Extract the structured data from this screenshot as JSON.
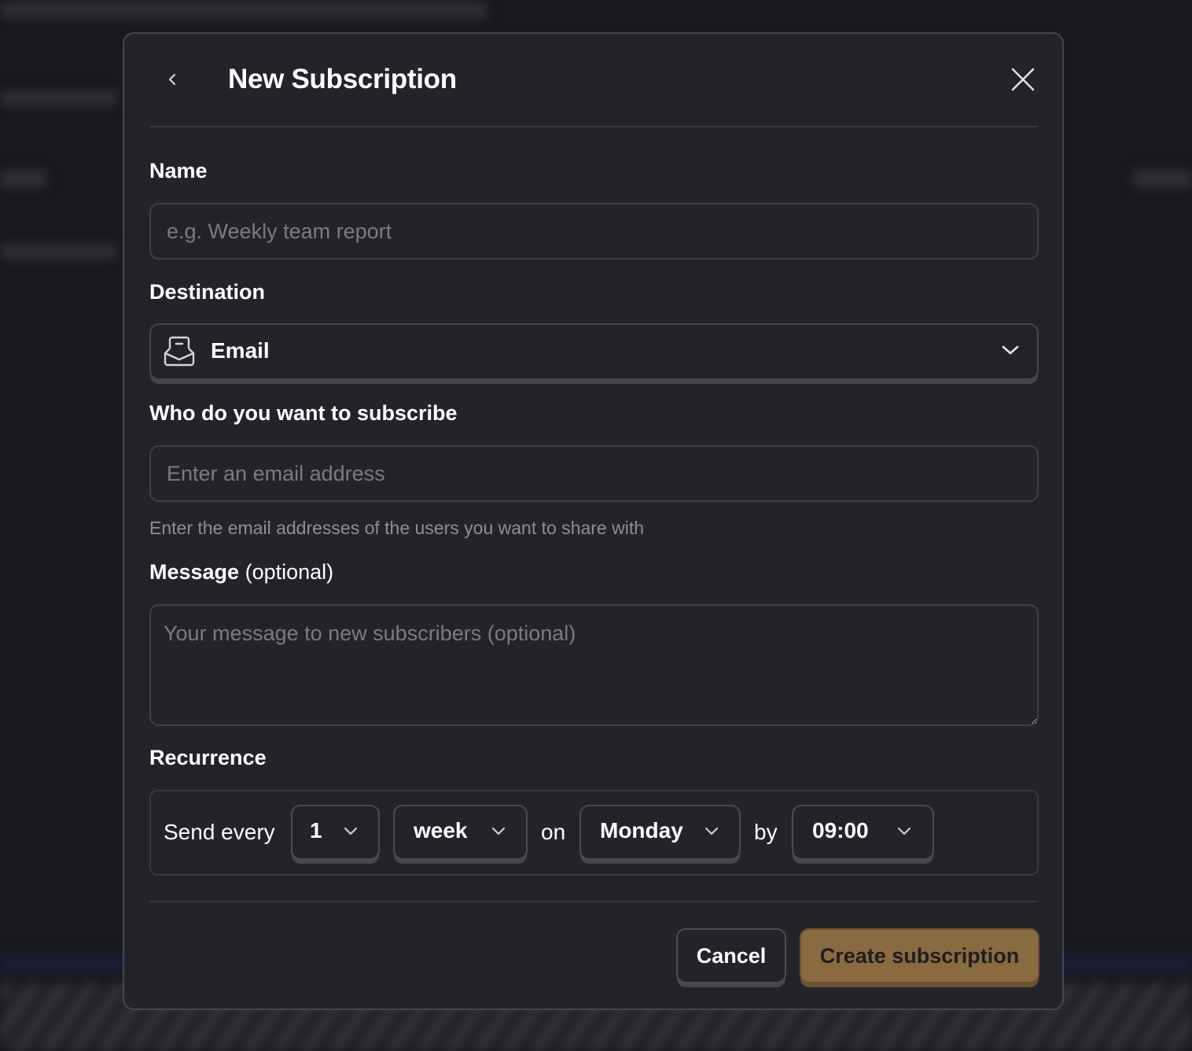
{
  "dialog": {
    "title": "New Subscription",
    "back_icon": "chevron-left-icon",
    "close_icon": "close-icon"
  },
  "name_field": {
    "label": "Name",
    "value": "",
    "placeholder": "e.g. Weekly team report"
  },
  "destination": {
    "label": "Destination",
    "icon": "inbox-icon",
    "selected": "Email"
  },
  "recipients": {
    "label": "Who do you want to subscribe",
    "value": "",
    "placeholder": "Enter an email address",
    "helper": "Enter the email addresses of the users you want to share with"
  },
  "message": {
    "label": "Message",
    "label_suffix": "(optional)",
    "value": "",
    "placeholder": "Your message to new subscribers (optional)"
  },
  "recurrence": {
    "label": "Recurrence",
    "send_every_text": "Send every",
    "interval": "1",
    "unit": "week",
    "on_text": "on",
    "day": "Monday",
    "by_text": "by",
    "time": "09:00"
  },
  "footer": {
    "cancel_label": "Cancel",
    "create_label": "Create subscription"
  },
  "colors": {
    "primary_button": "#8a6b40",
    "modal_background": "#23242a"
  }
}
